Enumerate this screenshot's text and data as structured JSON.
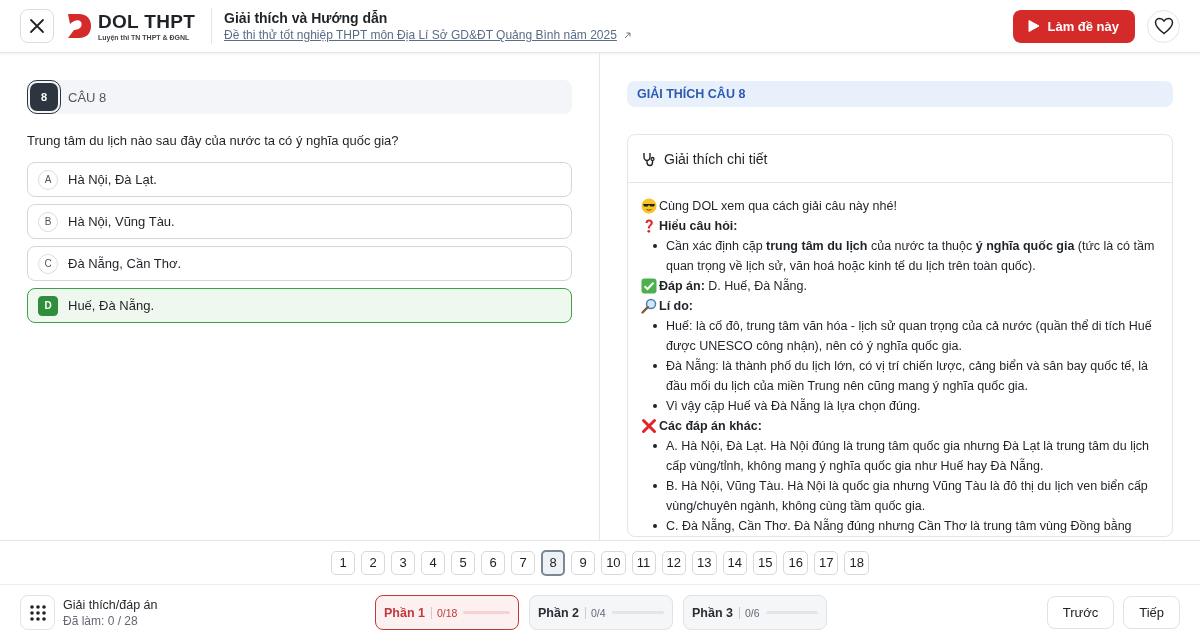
{
  "header": {
    "brand": "DOL THPT",
    "tagline": "Luyện thi TN THPT & ĐGNL",
    "title": "Giải thích và Hướng dẫn",
    "exam_link": "Đề thi thử tốt nghiệp THPT môn Địa Lí Sở GD&ĐT Quảng Bình năm 2025",
    "start_button": "Làm đề này",
    "favorite": false
  },
  "question": {
    "number": "8",
    "label": "CÂU 8",
    "text": "Trung tâm du lịch nào sau đây của nước ta có ý nghĩa quốc gia?",
    "options": [
      {
        "letter": "A",
        "text": "Hà Nội, Đà Lạt.",
        "selected": false
      },
      {
        "letter": "B",
        "text": "Hà Nội, Vũng Tàu.",
        "selected": false
      },
      {
        "letter": "C",
        "text": "Đà Nẵng, Cần Thơ.",
        "selected": false
      },
      {
        "letter": "D",
        "text": "Huế, Đà Nẵng.",
        "selected": true
      }
    ]
  },
  "explanation": {
    "heading": "GIẢI THÍCH CÂU 8",
    "card_title": "Giải thích chi tiết",
    "blocks": [
      {
        "kind": "intro",
        "text": "Cùng DOL xem qua cách giải câu này nhé!"
      },
      {
        "kind": "question",
        "text": "**Hiểu câu hỏi:**"
      },
      {
        "kind": "bullets",
        "items": [
          "Cần xác định cặp **trung tâm du lịch** của nước ta thuộc **ý nghĩa quốc gia** (tức là có tầm quan trọng về lịch sử, văn hoá hoặc kinh tế du lịch trên toàn quốc)."
        ]
      },
      {
        "kind": "answer",
        "text": "**Đáp án:** D. Huế, Đà Nẵng."
      },
      {
        "kind": "reason",
        "text": "**Lí do:**"
      },
      {
        "kind": "bullets",
        "items": [
          "Huế: là cố đô, trung tâm văn hóa - lịch sử quan trọng của cả nước (quần thể di tích Huế được UNESCO công nhận), nên có ý nghĩa quốc gia.",
          "Đà Nẵng: là thành phố du lịch lớn, có vị trí chiến lược, cảng biển và sân bay quốc tế, là đầu mối du lịch của miền Trung nên cũng mang ý nghĩa quốc gia.",
          "Vì vậy cặp Huế và Đà Nẵng là lựa chọn đúng."
        ]
      },
      {
        "kind": "wrong",
        "text": "**Các đáp án khác:**"
      },
      {
        "kind": "bullets",
        "items": [
          "A. Hà Nội, Đà Lạt. Hà Nội đúng là trung tâm quốc gia nhưng Đà Lạt là trung tâm du lịch cấp vùng/tỉnh, không mang ý nghĩa quốc gia như Huế hay Đà Nẵng.",
          "B. Hà Nội, Vũng Tàu. Hà Nội là quốc gia nhưng Vũng Tàu là đô thị du lịch ven biển cấp vùng/chuyên ngành, không cùng tầm quốc gia.",
          "C. Đà Nẵng, Cần Thơ. Đà Nẵng đúng nhưng Cần Thơ là trung tâm vùng Đồng bằng"
        ]
      }
    ]
  },
  "pages": [
    {
      "label": "1",
      "selected": false
    },
    {
      "label": "2",
      "selected": false
    },
    {
      "label": "3",
      "selected": false
    },
    {
      "label": "4",
      "selected": false
    },
    {
      "label": "5",
      "selected": false
    },
    {
      "label": "6",
      "selected": false
    },
    {
      "label": "7",
      "selected": false
    },
    {
      "label": "8",
      "selected": true
    },
    {
      "label": "9",
      "selected": false
    },
    {
      "label": "10",
      "selected": false
    },
    {
      "label": "11",
      "selected": false
    },
    {
      "label": "12",
      "selected": false
    },
    {
      "label": "13",
      "selected": false
    },
    {
      "label": "14",
      "selected": false
    },
    {
      "label": "15",
      "selected": false
    },
    {
      "label": "16",
      "selected": false
    },
    {
      "label": "17",
      "selected": false
    },
    {
      "label": "18",
      "selected": false
    }
  ],
  "footer": {
    "mode": "Giải thích/đáp án",
    "progress": "Đã làm: 0 / 28",
    "parts": [
      {
        "label": "Phần 1",
        "count": "0/18",
        "level": 0,
        "selected": true
      },
      {
        "label": "Phần 2",
        "count": "0/4",
        "level": 0,
        "selected": false
      },
      {
        "label": "Phần 3",
        "count": "0/6",
        "level": 0,
        "selected": false
      }
    ],
    "prev": "Trước",
    "next": "Tiếp"
  }
}
